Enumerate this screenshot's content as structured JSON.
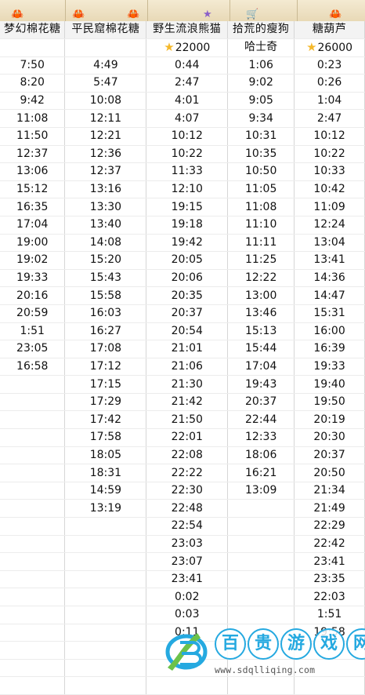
{
  "columns": [
    {
      "header": "梦幻棉花糖",
      "price": "",
      "price_star": false,
      "times": [
        "7:50",
        "8:20",
        "9:42",
        "11:08",
        "11:50",
        "12:37",
        "13:06",
        "15:12",
        "16:35",
        "17:04",
        "19:00",
        "19:02",
        "19:33",
        "20:16",
        "20:59",
        "1:51",
        "23:05",
        "16:58"
      ]
    },
    {
      "header": "平民窟棉花糖",
      "price": "",
      "price_star": false,
      "times": [
        "4:49",
        "5:47",
        "10:08",
        "12:11",
        "12:21",
        "12:36",
        "12:37",
        "13:16",
        "13:30",
        "13:40",
        "14:08",
        "15:20",
        "15:43",
        "15:58",
        "16:03",
        "16:27",
        "17:08",
        "17:12",
        "17:15",
        "17:29",
        "17:42",
        "17:58",
        "18:05",
        "18:31",
        "14:59",
        "13:19"
      ]
    },
    {
      "header": "野生流浪熊猫",
      "price": "22000",
      "price_star": true,
      "times": [
        "0:44",
        "2:47",
        "4:01",
        "4:07",
        "10:12",
        "10:22",
        "11:33",
        "12:10",
        "19:15",
        "19:18",
        "19:42",
        "20:05",
        "20:06",
        "20:35",
        "20:37",
        "20:54",
        "21:01",
        "21:06",
        "21:30",
        "21:42",
        "21:50",
        "22:01",
        "22:08",
        "22:22",
        "22:30",
        "22:48",
        "22:54",
        "23:03",
        "23:07",
        "23:41",
        "0:02",
        "0:03",
        "0:11"
      ]
    },
    {
      "header": "拾荒的瘦狗",
      "price": "哈士奇",
      "price_star": false,
      "times": [
        "1:06",
        "9:02",
        "9:05",
        "9:34",
        "10:31",
        "10:35",
        "10:50",
        "11:05",
        "11:08",
        "11:10",
        "11:11",
        "11:25",
        "12:22",
        "13:00",
        "13:46",
        "15:13",
        "15:44",
        "17:04",
        "19:43",
        "20:37",
        "22:44",
        "12:33",
        "18:06",
        "16:21",
        "13:09"
      ]
    },
    {
      "header": "糖葫芦",
      "price": "26000",
      "price_star": true,
      "times": [
        "0:23",
        "0:26",
        "1:04",
        "2:47",
        "10:12",
        "10:22",
        "10:33",
        "10:42",
        "11:09",
        "12:24",
        "13:04",
        "13:41",
        "14:36",
        "14:47",
        "15:31",
        "16:00",
        "16:39",
        "19:33",
        "19:40",
        "19:50",
        "20:19",
        "20:30",
        "20:37",
        "20:50",
        "21:34",
        "21:49",
        "22:29",
        "22:42",
        "23:41",
        "23:35",
        "22:03",
        "1:51",
        "19:58"
      ]
    }
  ],
  "star_icon": "star-icon",
  "watermark": {
    "chars": [
      "百",
      "贵",
      "游",
      "戏",
      "网"
    ],
    "url": "www.sdqlliqing.com",
    "color": "#25a9e0"
  }
}
